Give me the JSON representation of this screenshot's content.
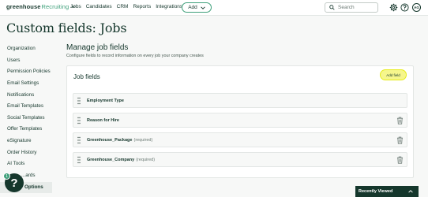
{
  "brand": {
    "name_bold": "greenhouse",
    "name_light": "Recruiting"
  },
  "nav": {
    "links": [
      "Jobs",
      "Candidates",
      "CRM",
      "Reports",
      "Integrations"
    ],
    "add_label": "Add"
  },
  "search": {
    "placeholder": "Search"
  },
  "user": {
    "initials": "AG"
  },
  "page": {
    "title": "Custom fields: Jobs"
  },
  "sidebar": {
    "items": [
      "Organization",
      "Users",
      "Permission Policies",
      "Email Settings",
      "Notifications",
      "Email Templates",
      "Social Templates",
      "Offer Templates",
      "eSignature",
      "Order History",
      "AI Tools",
      "...ards"
    ],
    "active_label": "Options"
  },
  "help": {
    "symbol": "?",
    "badge": "1"
  },
  "main": {
    "title": "Manage job fields",
    "subtitle": "Configure fields to record information on every job your company creates",
    "card_title": "Job fields",
    "add_field_label": "Add field",
    "fields": [
      {
        "name": "Employment Type",
        "tag": ""
      },
      {
        "name": "Reason for Hire",
        "tag": ""
      },
      {
        "name": "Greenhouse_Package",
        "tag": "(required)"
      },
      {
        "name": "Greenhouse_Company",
        "tag": "(required)"
      }
    ]
  },
  "recently_viewed": {
    "label": "Recently Viewed"
  },
  "colors": {
    "brand_dark": "#15372c",
    "brand_green": "#3ea07a",
    "highlight": "#f6f68c"
  }
}
